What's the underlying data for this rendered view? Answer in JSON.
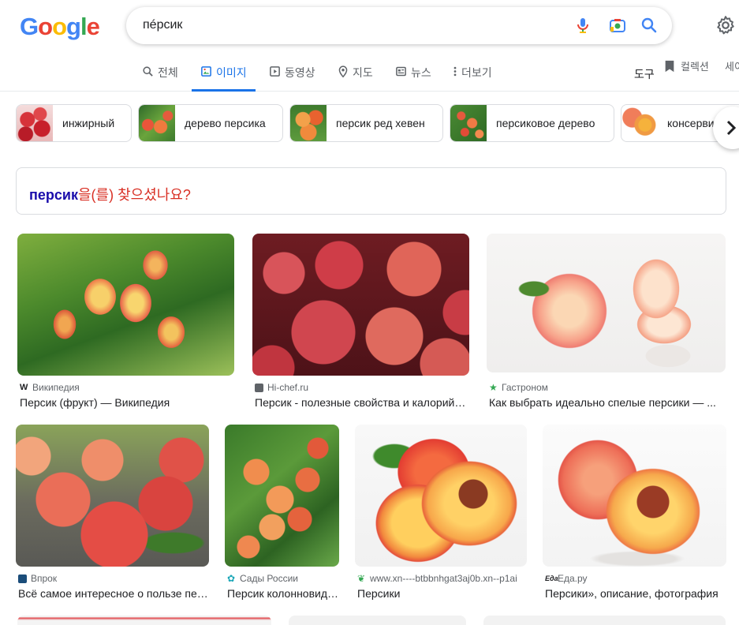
{
  "logo": {
    "letters": [
      "G",
      "o",
      "o",
      "g",
      "l",
      "e"
    ]
  },
  "search": {
    "query": "пéрсик"
  },
  "tabs": [
    {
      "label": "전체",
      "icon": "search-icon"
    },
    {
      "label": "이미지",
      "icon": "image-icon",
      "active": true
    },
    {
      "label": "동영상",
      "icon": "video-icon"
    },
    {
      "label": "지도",
      "icon": "map-pin-icon"
    },
    {
      "label": "뉴스",
      "icon": "news-icon"
    },
    {
      "label": "더보기",
      "icon": "more-vert-icon"
    }
  ],
  "toolbar": {
    "tools": "도구",
    "collections": "컬렉션",
    "save": "세이"
  },
  "chips": [
    {
      "label": "инжирный"
    },
    {
      "label": "дерево персика"
    },
    {
      "label": "персик ред хевен"
    },
    {
      "label": "персиковое дерево"
    },
    {
      "label": "консерви"
    }
  ],
  "suggestion": {
    "term": "персик",
    "rest": "을(를) 찾으셨나요?"
  },
  "results": [
    {
      "source": "Википедия",
      "title": "Персик (фрукт) — Википедия"
    },
    {
      "source": "Hi-chef.ru",
      "title": "Персик - полезные свойства и калорийность"
    },
    {
      "source": "Гастроном",
      "title": "Как выбрать идеально спелые персики — ..."
    },
    {
      "source": "Впрок",
      "title": "Всё самое интересное о пользе персиков"
    },
    {
      "source": "Сады России",
      "title": "Персик колонновидный"
    },
    {
      "source": "www.xn----btbbnhgat3aj0b.xn--p1ai",
      "title": "Персики"
    },
    {
      "source": "Еда.ру",
      "title": "Персики», описание, фотография"
    }
  ],
  "colors": {
    "accent": "#1a73e8",
    "link": "#1a0dab",
    "suggest_red": "#d93025"
  }
}
